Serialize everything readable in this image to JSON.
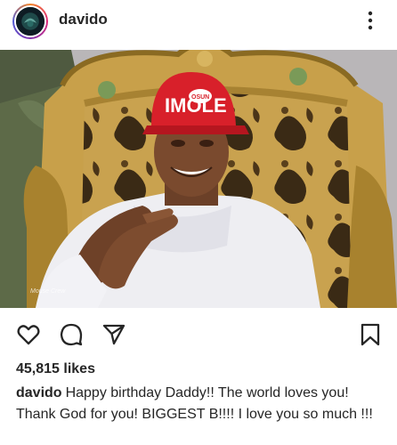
{
  "post": {
    "username": "davido",
    "photo_watermark": "Mouse Crew",
    "likes": "45,815 likes",
    "caption_user": "davido",
    "caption_text": "Happy birthday Daddy!! The world loves you! Thank God for you! BIGGEST B!!!! I love you so much !!!"
  },
  "photo": {
    "hat_text": "IMOLE",
    "hat_badge": "OSUN"
  },
  "icons": {
    "more": "more-vertical-icon",
    "like": "heart-icon",
    "comment": "comment-bubble-icon",
    "share": "paper-plane-icon",
    "save": "bookmark-icon"
  },
  "colors": {
    "hat_red": "#d8202a",
    "chair_gold": "#c8a04a",
    "text": "#262626"
  }
}
